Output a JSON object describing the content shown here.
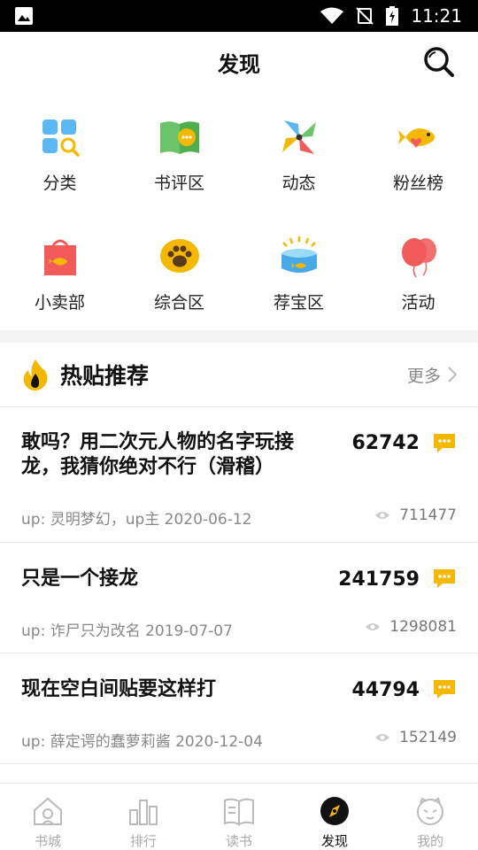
{
  "status_bar": {
    "time": "11:21"
  },
  "header": {
    "title": "发现"
  },
  "categories": [
    {
      "label": "分类",
      "icon": "grid-magnifier-icon"
    },
    {
      "label": "书评区",
      "icon": "open-book-chat-icon"
    },
    {
      "label": "动态",
      "icon": "pinwheel-icon"
    },
    {
      "label": "粉丝榜",
      "icon": "fish-heart-icon"
    },
    {
      "label": "小卖部",
      "icon": "shopping-bag-icon"
    },
    {
      "label": "综合区",
      "icon": "paw-icon"
    },
    {
      "label": "荐宝区",
      "icon": "fishbowl-icon"
    },
    {
      "label": "活动",
      "icon": "balloons-icon"
    }
  ],
  "hot_section": {
    "title": "热贴推荐",
    "more": "更多"
  },
  "posts": [
    {
      "title": "敢吗？用二次元人物的名字玩接龙，我猜你绝对不行（滑稽）",
      "replies": "62742",
      "meta": "up: 灵明梦幻，up主 2020-06-12",
      "views": "711477"
    },
    {
      "title": "只是一个接龙",
      "replies": "241759",
      "meta": "up: 诈尸只为改名 2019-07-07",
      "views": "1298081"
    },
    {
      "title": "现在空白间贴要这样打",
      "replies": "44794",
      "meta": "up: 薛定谔的蠢萝莉酱 2020-12-04",
      "views": "152149"
    }
  ],
  "tabs": [
    {
      "label": "书城",
      "icon": "house-icon"
    },
    {
      "label": "排行",
      "icon": "bar-chart-icon"
    },
    {
      "label": "读书",
      "icon": "book-icon"
    },
    {
      "label": "发现",
      "icon": "compass-icon",
      "active": true
    },
    {
      "label": "我的",
      "icon": "cat-face-icon"
    }
  ],
  "colors": {
    "accent": "#F5B800",
    "active_tab": "#111111"
  }
}
